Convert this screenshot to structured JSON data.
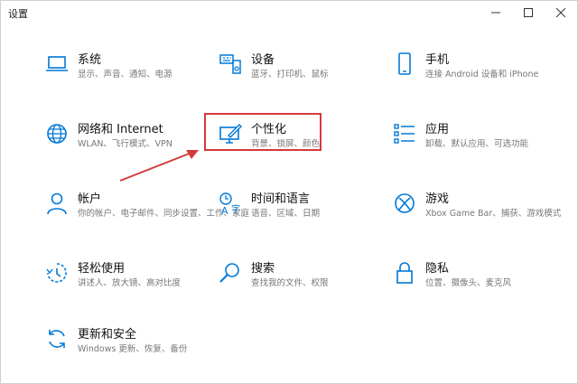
{
  "window": {
    "title": "设置",
    "minimize_icon": "minimize-icon",
    "maximize_icon": "maximize-icon",
    "close_icon": "close-icon"
  },
  "tiles": [
    {
      "id": "system",
      "name": "系统",
      "desc": "显示、声音、通知、电源",
      "icon": "laptop-icon"
    },
    {
      "id": "devices",
      "name": "设备",
      "desc": "蓝牙、打印机、鼠标",
      "icon": "keyboard-speaker-icon"
    },
    {
      "id": "phone",
      "name": "手机",
      "desc": "连接 Android 设备和 iPhone",
      "icon": "phone-icon"
    },
    {
      "id": "network",
      "name": "网络和 Internet",
      "desc": "WLAN、飞行模式、VPN",
      "icon": "globe-icon"
    },
    {
      "id": "personalization",
      "name": "个性化",
      "desc": "背景、锁屏、颜色",
      "icon": "monitor-pen-icon"
    },
    {
      "id": "apps",
      "name": "应用",
      "desc": "卸载、默认应用、可选功能",
      "icon": "apps-list-icon"
    },
    {
      "id": "accounts",
      "name": "帐户",
      "desc": "你的帐户、电子邮件、同步设置、工作、家庭",
      "icon": "person-icon"
    },
    {
      "id": "time",
      "name": "时间和语言",
      "desc": "语音、区域、日期",
      "icon": "time-language-icon"
    },
    {
      "id": "gaming",
      "name": "游戏",
      "desc": "Xbox Game Bar、捕获、游戏模式",
      "icon": "xbox-icon"
    },
    {
      "id": "ease",
      "name": "轻松使用",
      "desc": "讲述人、放大镜、高对比度",
      "icon": "ease-of-access-icon"
    },
    {
      "id": "search",
      "name": "搜索",
      "desc": "查找我的文件、权限",
      "icon": "search-icon"
    },
    {
      "id": "privacy",
      "name": "隐私",
      "desc": "位置、摄像头、麦克风",
      "icon": "lock-icon"
    },
    {
      "id": "update",
      "name": "更新和安全",
      "desc": "Windows 更新、恢复、备份",
      "icon": "sync-icon"
    }
  ],
  "colors": {
    "accent": "#0078d7",
    "highlight": "#d43a3a"
  }
}
